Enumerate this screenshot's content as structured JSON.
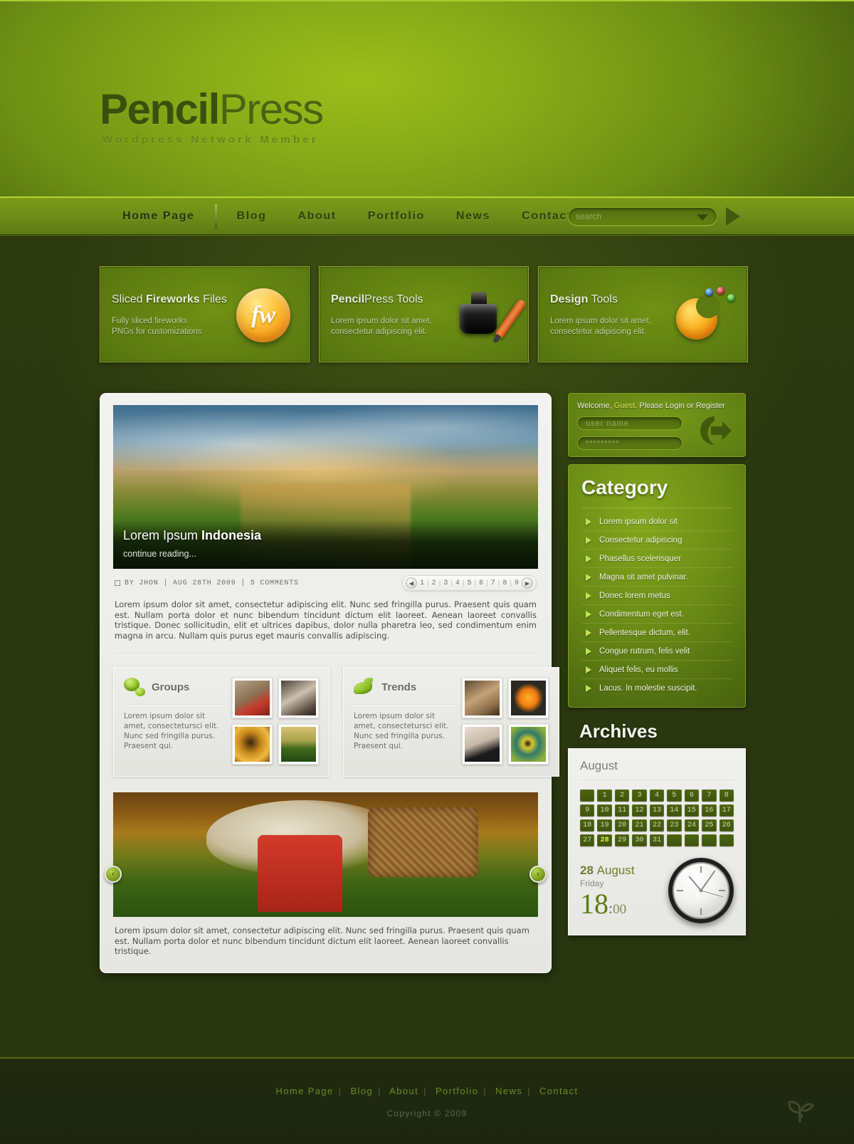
{
  "site": {
    "logo_main": "Pencil",
    "logo_accent": "Press",
    "tagline": "Wordpress Network Member"
  },
  "nav": {
    "items": [
      {
        "label": "Home Page",
        "active": true
      },
      {
        "label": "Blog",
        "active": false
      },
      {
        "label": "About",
        "active": false
      },
      {
        "label": "Portfolio",
        "active": false
      },
      {
        "label": "News",
        "active": false
      },
      {
        "label": "Contact",
        "active": false
      }
    ],
    "search": {
      "placeholder": "search",
      "value": ""
    }
  },
  "features": [
    {
      "title_plain_a": "Sliced ",
      "title_bold": "Fireworks",
      "title_plain_b": " Files",
      "desc": "Fully sliced fireworks\nPNGs for customizations",
      "icon": "fireworks-icon"
    },
    {
      "title_plain_a": "",
      "title_bold": "Pencil",
      "title_plain_b": "Press Tools",
      "desc": "Lorem ipsum dolor sit amet,\nconsectetur adipiscing elit.",
      "icon": "inkwell-pen-icon"
    },
    {
      "title_plain_a": "",
      "title_bold": "Design",
      "title_plain_b": " Tools",
      "desc": "Lorem ipsum dolor sit amet,\nconsectetur adipiscing elit.",
      "icon": "design-swoosh-icon"
    }
  ],
  "article": {
    "hero_title_plain": "Lorem Ipsum ",
    "hero_title_bold": "Indonesia",
    "continue_label": "continue reading...",
    "meta": "BY JHON  |  AUG 28TH 2009  |  5 COMMENTS",
    "pagination": [
      "1",
      "2",
      "3",
      "4",
      "5",
      "6",
      "7",
      "8",
      "9"
    ],
    "body": "Lorem ipsum dolor sit amet, consectetur adipiscing elit. Nunc sed fringilla purus. Praesent quis quam est. Nullam porta dolor et nunc bibendum tincidunt dictum elit laoreet. Aenean laoreet convallis tristique. Donec sollicitudin, elit et ultrices dapibus, dolor nulla pharetra leo, sed condimentum enim magna in arcu. Nullam quis purus eget mauris convallis adipiscing."
  },
  "widgets": [
    {
      "title": "Groups",
      "icon": "bubble-icon",
      "text": "Lorem ipsum dolor sit amet, consectetursci elit. Nunc sed fringilla purus. Praesent qui.",
      "thumbs": [
        "thumb-red-shoe",
        "thumb-portrait-bw",
        "thumb-golden-eye",
        "thumb-lone-tree"
      ]
    },
    {
      "title": "Trends",
      "icon": "leaf-icon",
      "text": "Lorem ipsum dolor sit amet, consectetursci elit. Nunc sed fringilla purus. Praesent qui.",
      "thumbs": [
        "thumb-face-leaf",
        "thumb-orange-slice",
        "thumb-ink-drop",
        "thumb-green-eye"
      ]
    }
  ],
  "carousel": {
    "prev_label": "‹",
    "next_label": "›",
    "caption": "Lorem ipsum dolor sit amet, consectetur adipiscing elit. Nunc sed fringilla purus. Praesent quis quam est. Nullam porta dolor et nunc bibendum tincidunt dictum elit laoreet. Aenean laoreet convallis tristique."
  },
  "login": {
    "welcome_pre": "Welcome, ",
    "guest": "Guest",
    "welcome_post": ". Please Login or Register",
    "username_placeholder": "user name",
    "password_placeholder": "*********",
    "submit_icon": "login-arrow-icon"
  },
  "category": {
    "title": "Category",
    "items": [
      "Lorem ipsum dolor sit",
      "Consectetur adipiscing",
      "Phasellus scelerisquer",
      "Magna sit amet pulvinar.",
      "Donec lorem metus",
      "Condimentum eget est.",
      "Pellentesque dictum, elit.",
      "Congue rutrum, felis velit",
      "Aliquet felis, eu mollis",
      "Lacus. In molestie suscipit."
    ]
  },
  "archives": {
    "title": "Archives",
    "month": "August",
    "days": [
      "",
      "1",
      "2",
      "3",
      "4",
      "5",
      "6",
      "7",
      "8",
      "9",
      "10",
      "11",
      "12",
      "13",
      "14",
      "15",
      "16",
      "17",
      "18",
      "19",
      "20",
      "21",
      "22",
      "23",
      "24",
      "25",
      "26",
      "27",
      "28",
      "29",
      "30",
      "31",
      "",
      "",
      "",
      ""
    ],
    "today": "28",
    "date_number": "28",
    "date_month": "August",
    "weekday": "Friday",
    "hours": "18",
    "separator": ":",
    "minutes": "00"
  },
  "footer": {
    "links": [
      "Home Page",
      "Blog",
      "About",
      "Portfolio",
      "News",
      "Contact"
    ],
    "separator": "|",
    "copyright": "Copyright © 2009",
    "watermark_icon": "sprout-icon"
  },
  "colors": {
    "brand_green": "#7b9a16",
    "accent_lime": "#c5e05c",
    "dark_bg": "#2b380f",
    "highlight_yellow": "#e2f24a"
  }
}
